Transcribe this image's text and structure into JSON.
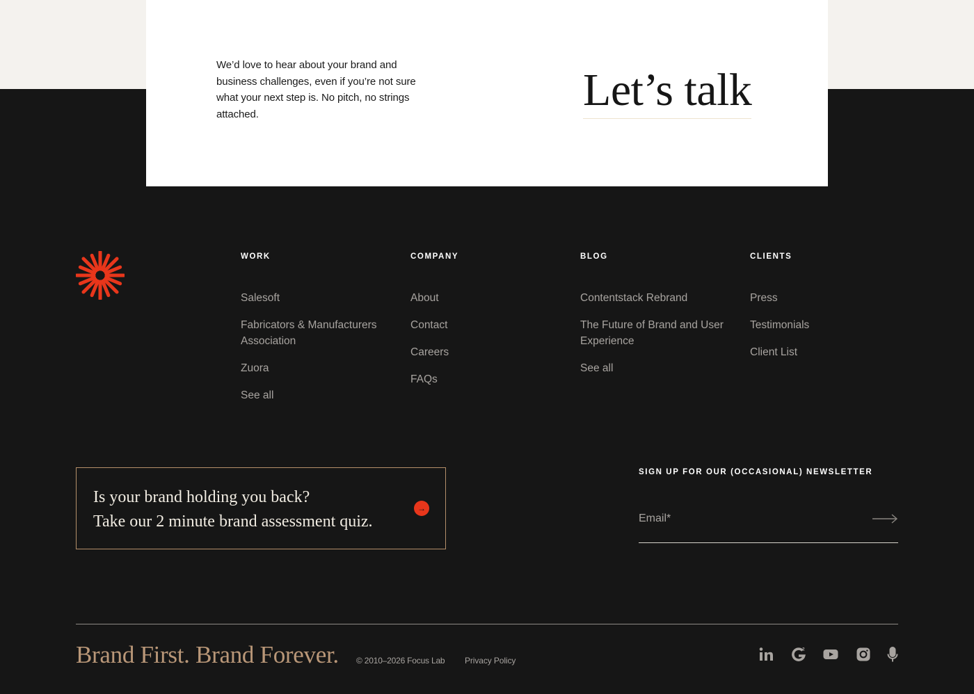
{
  "cta": {
    "text": "We’d love to hear about your brand and business challenges, even if you’re not sure what your next step is. No pitch, no strings attached.",
    "heading": "Let’s talk"
  },
  "logo": {
    "icon": "starburst-icon",
    "color": "#e8361b"
  },
  "nav": {
    "work": {
      "title": "WORK",
      "items": [
        "Salesoft",
        "Fabricators & Manufacturers Association",
        "Zuora",
        "See all"
      ]
    },
    "company": {
      "title": "COMPANY",
      "items": [
        "About",
        "Contact",
        "Careers",
        "FAQs"
      ]
    },
    "blog": {
      "title": "BLOG",
      "items": [
        "Contentstack Rebrand",
        "The Future of Brand and User Experience",
        "See all"
      ]
    },
    "clients": {
      "title": "CLIENTS",
      "items": [
        "Press",
        "Testimonials",
        "Client List"
      ]
    }
  },
  "quiz": {
    "line1": "Is your brand holding you back?",
    "line2": "Take our 2 minute brand assessment quiz.",
    "arrow": "→",
    "arrow_color": "#e8361b"
  },
  "newsletter": {
    "title": "SIGN UP FOR OUR (OCCASIONAL) NEWSLETTER",
    "email_placeholder": "Email*",
    "email_value": "",
    "submit_icon": "arrow-right-icon"
  },
  "footer": {
    "tagline": "Brand First. Brand Forever.",
    "copyright": "© 2010–2026 Focus Lab",
    "privacy": "Privacy Policy",
    "social": [
      "linkedin-icon",
      "g2-icon",
      "youtube-icon",
      "instagram-icon",
      "microphone-icon"
    ]
  },
  "colors": {
    "background": "#161616",
    "accent": "#e8361b",
    "tagline": "#b99778",
    "band": "#f4f2ee"
  }
}
